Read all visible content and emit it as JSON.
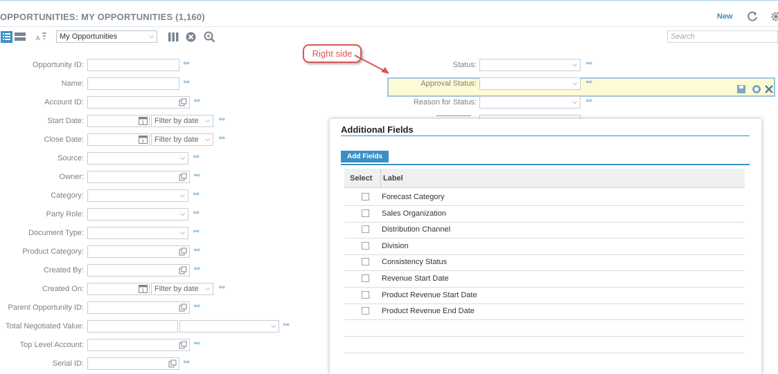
{
  "header": {
    "title": "OPPORTUNITIES: MY OPPORTUNITIES (1,160)",
    "new_label": "New"
  },
  "toolbar": {
    "view_select": "My Opportunities",
    "search_placeholder": "Search"
  },
  "annotation": {
    "text": "Right side"
  },
  "left_filters": [
    {
      "label": "Opportunity ID:"
    },
    {
      "label": "Name:"
    },
    {
      "label": "Account ID:"
    },
    {
      "label": "Start Date:",
      "select": "Filter by date"
    },
    {
      "label": "Close Date:",
      "select": "Filter by date"
    },
    {
      "label": "Source:"
    },
    {
      "label": "Owner:"
    },
    {
      "label": "Category:"
    },
    {
      "label": "Party Role:"
    },
    {
      "label": "Document Type:"
    },
    {
      "label": "Product Category:"
    },
    {
      "label": "Created By:"
    },
    {
      "label": "Created On:",
      "select": "Filter by date"
    },
    {
      "label": "Parent Opportunity ID:"
    },
    {
      "label": "Total Negotiated Value:"
    },
    {
      "label": "Top Level Account:"
    },
    {
      "label": "Serial ID:"
    }
  ],
  "right_filters": [
    {
      "label": "Status:"
    },
    {
      "label": "Approval Status:"
    },
    {
      "label": "Reason for Status:"
    }
  ],
  "additional_fields": {
    "title": "Additional Fields",
    "tab": "Add Fields",
    "columns": [
      "Select",
      "Label"
    ],
    "rows": [
      {
        "label": "Forecast Category"
      },
      {
        "label": "Sales Organization"
      },
      {
        "label": "Distribution Channel"
      },
      {
        "label": "Division"
      },
      {
        "label": "Consistency Status"
      },
      {
        "label": "Revenue Start Date"
      },
      {
        "label": "Product Revenue Start Date"
      },
      {
        "label": "Product Revenue End Date"
      }
    ]
  }
}
